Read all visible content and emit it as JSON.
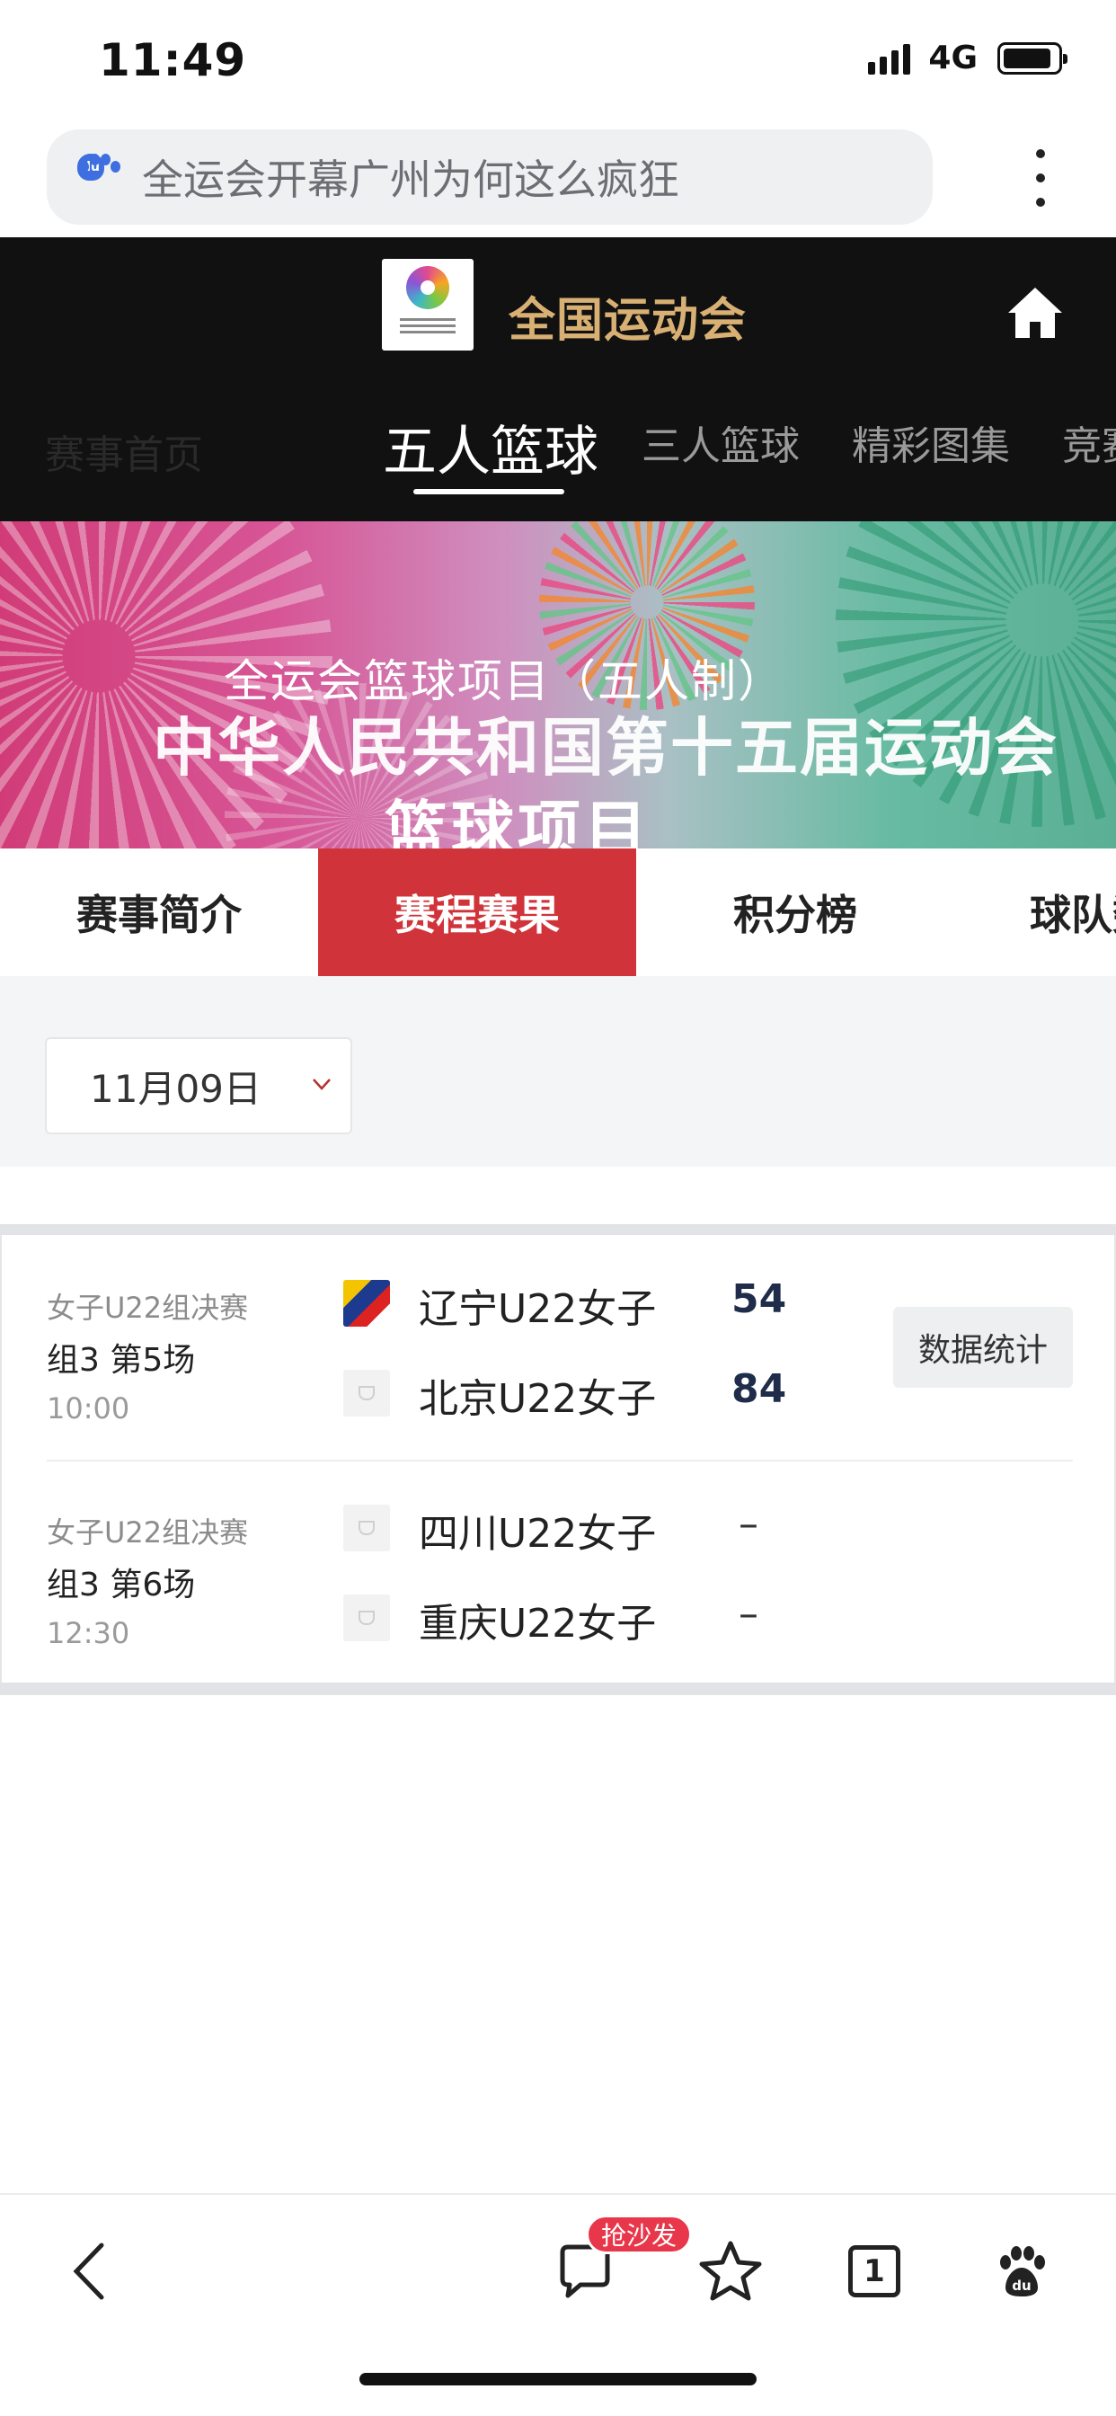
{
  "status_bar": {
    "time": "11:49",
    "network": "4G",
    "battery_level": 0.9
  },
  "browser": {
    "search_query": "全运会开幕广州为何这么疯狂"
  },
  "site": {
    "title": "全国运动会",
    "nav_tabs": [
      {
        "label": "赛事首页"
      },
      {
        "label": "五人篮球",
        "active": true
      },
      {
        "label": "三人篮球"
      },
      {
        "label": "精彩图集"
      },
      {
        "label": "竞赛"
      }
    ]
  },
  "banner": {
    "subtitle": "全运会篮球项目（五人制）",
    "title_line1": "中华人民共和国第十五届运动会",
    "title_line2": "篮球项目"
  },
  "sub_tabs": [
    {
      "label": "赛事简介"
    },
    {
      "label": "赛程赛果",
      "active": true
    },
    {
      "label": "积分榜"
    },
    {
      "label": "球队数据"
    }
  ],
  "filter": {
    "date": "11月09日"
  },
  "matches": [
    {
      "stage": "女子U22组决赛",
      "group": "组3 第5场",
      "time": "10:00",
      "home": {
        "name": "辽宁U22女子",
        "score": "54"
      },
      "away": {
        "name": "北京U22女子",
        "score": "84"
      },
      "stats_label": "数据统计"
    },
    {
      "stage": "女子U22组决赛",
      "group": "组3 第6场",
      "time": "12:30",
      "home": {
        "name": "四川U22女子",
        "score": "–"
      },
      "away": {
        "name": "重庆U22女子",
        "score": "–"
      }
    }
  ],
  "toolbar": {
    "comment_badge": "抢沙发",
    "tab_count": "1"
  },
  "colors": {
    "accent_red": "#d0343a",
    "header_bg": "#111111",
    "title_gold": "#d9b073"
  }
}
